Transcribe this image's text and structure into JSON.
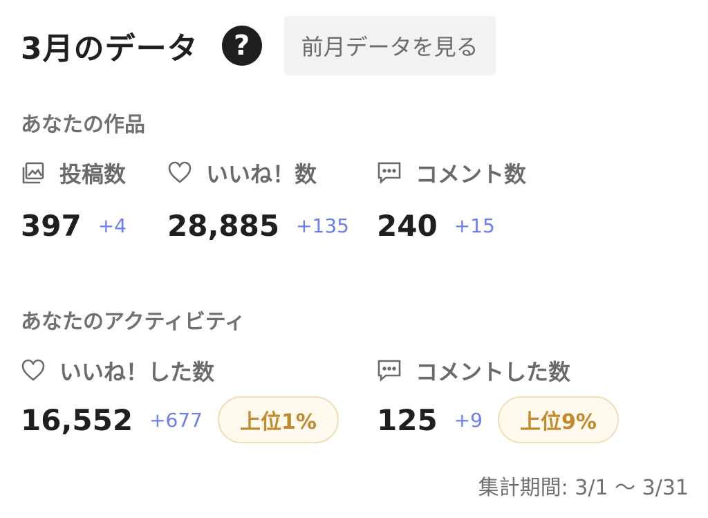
{
  "header": {
    "title": "3月のデータ",
    "help_glyph": "?",
    "prev_button": "前月データを見る"
  },
  "works": {
    "title": "あなたの作品",
    "posts": {
      "icon": "gallery-icon",
      "label": "投稿数",
      "value": "397",
      "delta": "+4"
    },
    "likes": {
      "icon": "heart-icon",
      "label": "いいね！数",
      "value": "28,885",
      "delta": "+135"
    },
    "comments": {
      "icon": "comment-icon",
      "label": "コメント数",
      "value": "240",
      "delta": "+15"
    }
  },
  "activity": {
    "title": "あなたのアクティビティ",
    "likes_given": {
      "icon": "heart-icon",
      "label": "いいね！した数",
      "value": "16,552",
      "delta": "+677",
      "rank": "上位1%"
    },
    "comments_given": {
      "icon": "comment-icon",
      "label": "コメントした数",
      "value": "125",
      "delta": "+9",
      "rank": "上位9%"
    }
  },
  "period": "集計期間: 3/1 〜 3/31",
  "colors": {
    "accent": "#6a7ef0",
    "badge_text": "#c08a2e",
    "badge_border": "#f0ddb5"
  }
}
